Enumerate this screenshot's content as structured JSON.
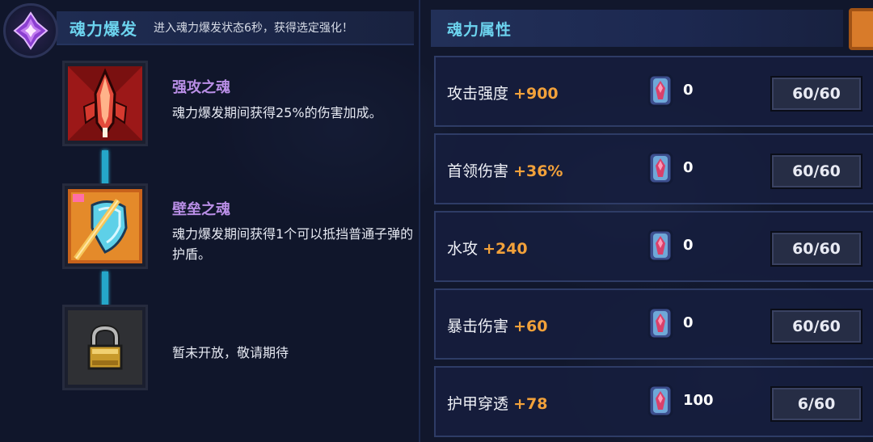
{
  "panel": {
    "title": "魂力爆发",
    "subtitle": "进入魂力爆发状态6秒，获得选定强化！"
  },
  "skills": [
    {
      "name": "强攻之魂",
      "desc": "魂力爆发期间获得25%的伤害加成。",
      "icon": "attack-soul-icon"
    },
    {
      "name": "壁垒之魂",
      "desc": "魂力爆发期间获得1个可以抵挡普通子弹的护盾。",
      "icon": "shield-soul-icon"
    },
    {
      "name": "",
      "desc": "暂未开放，敬请期待",
      "icon": "lock-icon"
    }
  ],
  "attributes": {
    "title": "魂力属性",
    "rows": [
      {
        "label": "攻击强度",
        "bonus": "+900",
        "gems": "0",
        "level": "60/60"
      },
      {
        "label": "首领伤害",
        "bonus": "+36%",
        "gems": "0",
        "level": "60/60"
      },
      {
        "label": "水攻",
        "bonus": "+240",
        "gems": "0",
        "level": "60/60"
      },
      {
        "label": "暴击伤害",
        "bonus": "+60",
        "gems": "0",
        "level": "60/60"
      },
      {
        "label": "护甲穿透",
        "bonus": "+78",
        "gems": "100",
        "level": "6/60"
      }
    ]
  },
  "colors": {
    "accent": "#6cd3ee",
    "bonus": "#f2a13a",
    "skill_name": "#b98ee6",
    "orange_tab": "#d87b2a"
  }
}
